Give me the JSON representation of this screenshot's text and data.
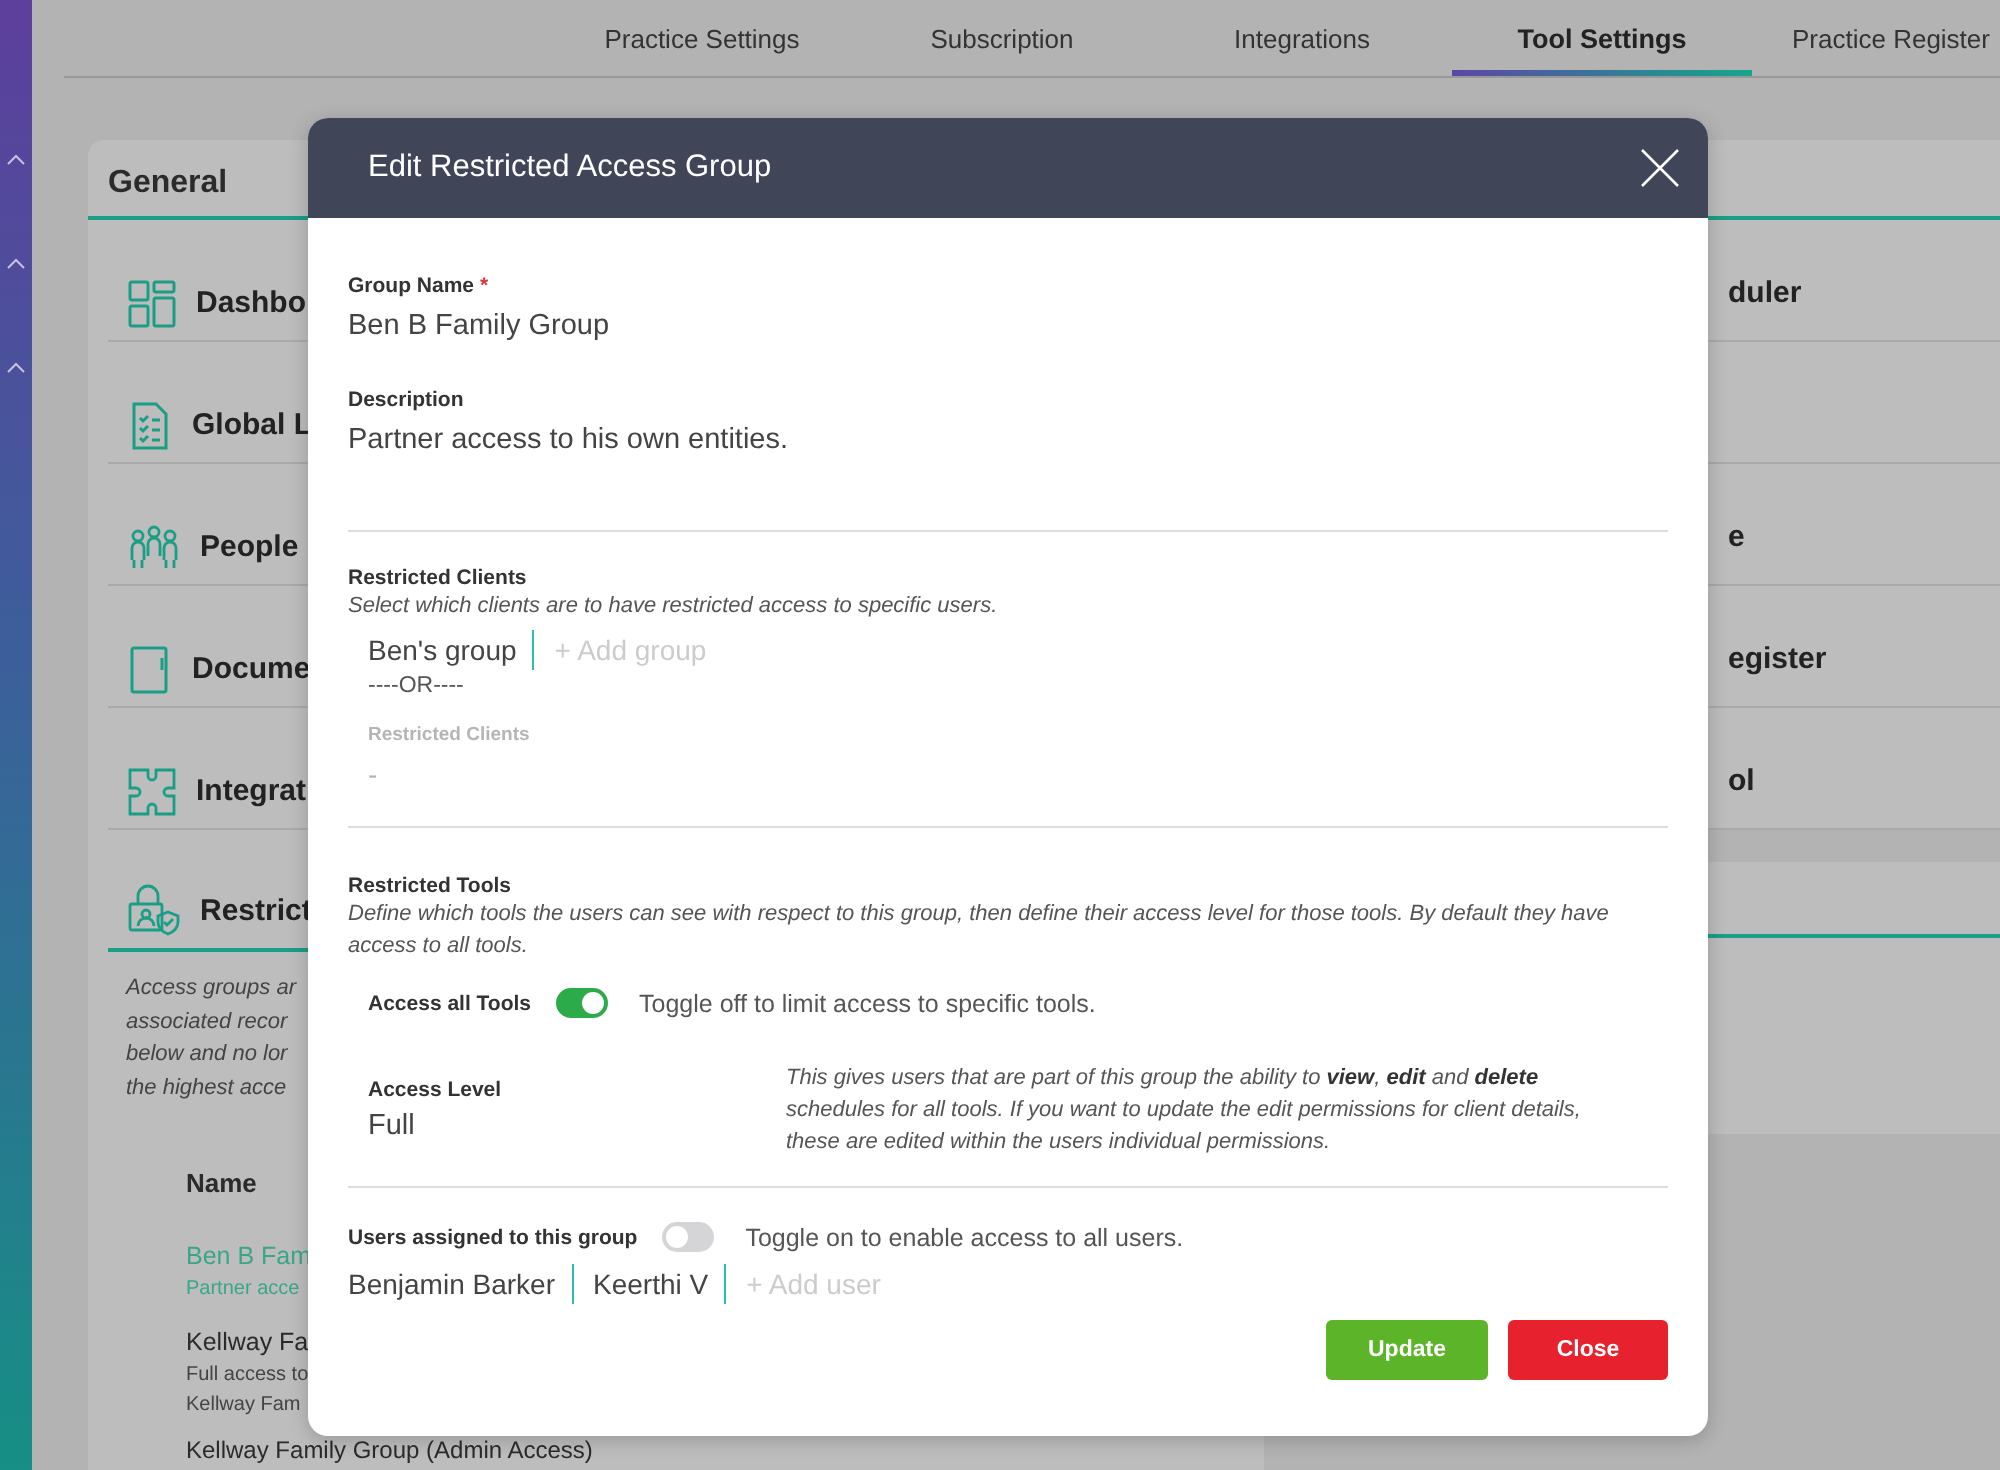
{
  "tabs": [
    {
      "label": "Practice Settings",
      "selected": false
    },
    {
      "label": "Subscription",
      "selected": false
    },
    {
      "label": "Integrations",
      "selected": false
    },
    {
      "label": "Tool Settings",
      "selected": true
    },
    {
      "label": "Practice Register",
      "selected": false
    }
  ],
  "general_panel": {
    "title": "General",
    "items": [
      {
        "label": "Dashbo",
        "selected": false
      },
      {
        "label": "Global L",
        "selected": false
      },
      {
        "label": "People",
        "selected": false
      },
      {
        "label": "Docume",
        "selected": false
      },
      {
        "label": "Integrat",
        "selected": false
      },
      {
        "label": "Restrict",
        "selected": true
      }
    ],
    "description": [
      "Access groups ar",
      "associated recor",
      "below and no lor",
      "the highest acce"
    ],
    "table": {
      "columns": [
        "Name"
      ],
      "rows": [
        {
          "name": "Ben B Fam",
          "details": [
            "Partner acce"
          ],
          "selected": true
        },
        {
          "name": "Kellway Fa",
          "details": [
            "Full access to",
            "Kellway Fam"
          ],
          "selected": false
        },
        {
          "name": "Kellway Family Group (Admin Access)",
          "selected": false
        }
      ]
    }
  },
  "right_panel": {
    "items": [
      {
        "label": "duler"
      },
      {
        "label": "e"
      },
      {
        "label": "egister"
      },
      {
        "label": "ol"
      }
    ]
  },
  "modal": {
    "title": "Edit Restricted Access Group",
    "group_name": {
      "label": "Group Name",
      "required_mark": "*",
      "value": "Ben B Family Group"
    },
    "description": {
      "label": "Description",
      "value": "Partner access to his own entities."
    },
    "restricted_clients": {
      "title": "Restricted Clients",
      "hint": "Select which clients are to have restricted access to specific users.",
      "tags": [
        "Ben's group"
      ],
      "add_label": "+ Add group",
      "separator": "----OR----",
      "sub_label": "Restricted Clients",
      "sub_value": "-"
    },
    "restricted_tools": {
      "title": "Restricted Tools",
      "hint": "Define which tools the users can see with respect to this group, then define their access level for those tools. By default they have access to all tools.",
      "toggle": {
        "label": "Access all Tools",
        "on": true,
        "hint": "Toggle off to limit access to specific tools."
      },
      "access_level": {
        "label": "Access Level",
        "value": "Full",
        "note": "This gives users that are part of this group the ability to **view**, **edit** and **delete** schedules for all tools. If you want to update the edit permissions for client details, these are edited within the users individual permissions."
      }
    },
    "users": {
      "label": "Users assigned to this group",
      "on": false,
      "hint": "Toggle on to enable access to all users.",
      "tags": [
        "Benjamin Barker",
        "Keerthi V"
      ],
      "add_label": "+ Add user"
    },
    "buttons": [
      {
        "label": "Update",
        "kind": "primary"
      },
      {
        "label": "Close",
        "kind": "danger"
      }
    ]
  }
}
